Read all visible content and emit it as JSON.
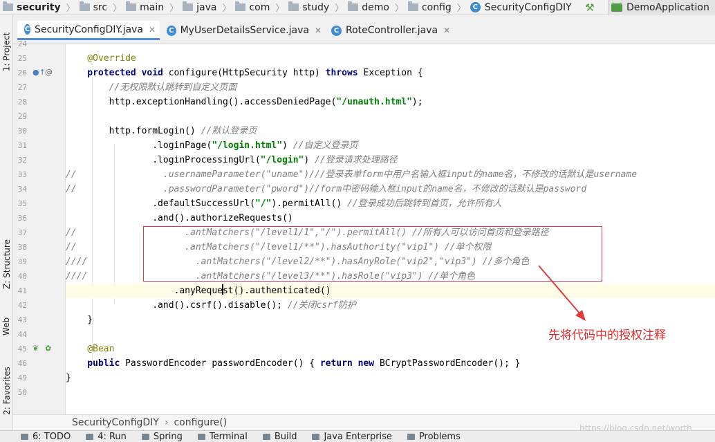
{
  "breadcrumb": {
    "items": [
      "security",
      "src",
      "main",
      "java",
      "com",
      "study",
      "demo",
      "config",
      "SecurityConfigDIY"
    ]
  },
  "run_config": {
    "label": "DemoApplication"
  },
  "left_tools": [
    "1: Project",
    "Z: Structure",
    "Web",
    "2: Favorites"
  ],
  "tabs": [
    {
      "label": "SecurityConfigDIY.java",
      "active": true
    },
    {
      "label": "MyUserDetailsService.java",
      "active": false
    },
    {
      "label": "RoteController.java",
      "active": false
    }
  ],
  "editor": {
    "line_numbers": [
      "24",
      "25",
      "26",
      "27",
      "28",
      "29",
      "30",
      "31",
      "32",
      "33",
      "34",
      "35",
      "36",
      "37",
      "38",
      "39",
      "40",
      "41",
      "42",
      "43",
      "44",
      "45",
      "46",
      "49",
      "50"
    ],
    "lines": [
      [],
      [
        [
          "ann",
          "    @Override"
        ]
      ],
      [
        [
          "kw",
          "    protected void "
        ],
        [
          "pl",
          "configure(HttpSecurity http) "
        ],
        [
          "kw",
          "throws "
        ],
        [
          "pl",
          "Exception {"
        ]
      ],
      [
        [
          "cm",
          "        //无权限默认跳转到自定义页面"
        ]
      ],
      [
        [
          "pl",
          "        http.exceptionHandling().accessDeniedPage("
        ],
        [
          "str",
          "\"/unauth.html\""
        ],
        [
          "pl",
          ");"
        ]
      ],
      [],
      [
        [
          "pl",
          "        http.formLogin() "
        ],
        [
          "cm",
          "//默认登录页"
        ]
      ],
      [
        [
          "pl",
          "                .loginPage("
        ],
        [
          "str",
          "\"/login.html\""
        ],
        [
          "pl",
          ") "
        ],
        [
          "cm",
          "//自定义登录页"
        ]
      ],
      [
        [
          "pl",
          "                .loginProcessingUrl("
        ],
        [
          "str",
          "\"/login\""
        ],
        [
          "pl",
          ") "
        ],
        [
          "cm",
          "//登录请求处理路径"
        ]
      ],
      [
        [
          "cm",
          "//                .usernameParameter(\"uname\")///登录表单form中用户名输入框input的name名，不修改的话默认是username"
        ]
      ],
      [
        [
          "cm",
          "//                .passwordParameter(\"pword\")//form中密码输入框input的name名，不修改的话默认是password"
        ]
      ],
      [
        [
          "pl",
          "                .defaultSuccessUrl("
        ],
        [
          "str",
          "\"/\""
        ],
        [
          "pl",
          ").permitAll() "
        ],
        [
          "cm",
          "//登录成功后跳转到首页，允许所有人"
        ]
      ],
      [
        [
          "pl",
          "                .and().authorizeRequests()"
        ]
      ],
      [
        [
          "cm",
          "//                    .antMatchers(\"/level1/1\",\"/\").permitAll() //所有人可以访问首页和登录路径"
        ]
      ],
      [
        [
          "cm",
          "//                    .antMatchers(\"/level1/**\").hasAuthority(\"vip1\") //单个权限"
        ]
      ],
      [
        [
          "cm",
          "////                    .antMatchers(\"/level2/**\").hasAnyRole(\"vip2\",\"vip3\") //多个角色"
        ]
      ],
      [
        [
          "cm",
          "////                    .antMatchers(\"/level3/**\").hasRole(\"vip3\") //单个角色"
        ]
      ],
      [
        [
          "pl",
          "                    .anyRequest().authenticated()"
        ]
      ],
      [
        [
          "pl",
          "                .and().csrf().disable(); "
        ],
        [
          "cm",
          "//关闭csrf防护"
        ]
      ],
      [
        [
          "pl",
          "    }"
        ]
      ],
      [],
      [
        [
          "ann",
          "    @Bean"
        ]
      ],
      [
        [
          "kw",
          "    public "
        ],
        [
          "pl",
          "PasswordEncoder passwordEncoder() { "
        ],
        [
          "kw",
          "return new "
        ],
        [
          "pl",
          "BCryptPasswordEncoder(); }"
        ]
      ],
      [
        [
          "pl",
          "}"
        ]
      ],
      []
    ]
  },
  "annotation": "先将代码中的授权注释",
  "navbar": {
    "class_name": "SecurityConfigDIY",
    "method": "configure()"
  },
  "bottom_tools": [
    "6: TODO",
    "4: Run",
    "Spring",
    "Terminal",
    "Build",
    "Java Enterprise",
    "Problems"
  ],
  "watermark": "https://blog.csdn.net/worth"
}
